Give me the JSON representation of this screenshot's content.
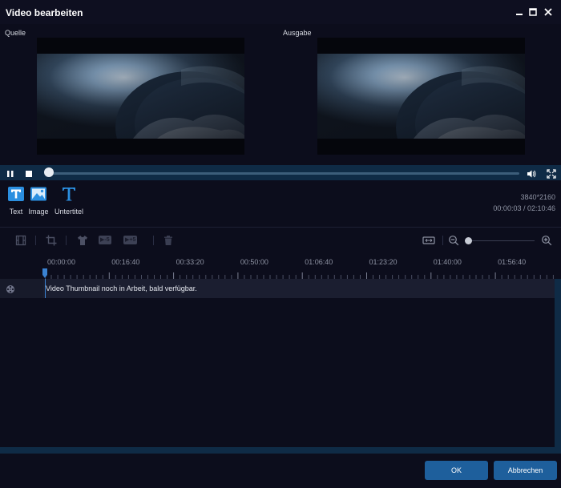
{
  "window": {
    "title": "Video bearbeiten",
    "controls": [
      "close-icon",
      "maximize-icon",
      "minimize-icon"
    ]
  },
  "preview": {
    "source_label": "Quelle",
    "output_label": "Ausgabe"
  },
  "player": {
    "progress_fraction": 0.0004,
    "buttons": [
      "pause-icon",
      "stop-icon",
      "volume-icon",
      "fullscreen-icon"
    ]
  },
  "tools": [
    {
      "label": "Text",
      "icon": "text-icon"
    },
    {
      "label": "Image",
      "icon": "image-icon"
    },
    {
      "label": "Untertitel",
      "icon": "subtitle-icon"
    }
  ],
  "info": {
    "resolution": "3840*2160",
    "time": "00:00:03 / 02:10:46"
  },
  "timeline_toolbar": {
    "icons": [
      "film-icon",
      "crop-icon",
      "shirt-icon",
      "rewind-5-icon",
      "forward-5-icon",
      "trash-icon",
      "fit-width-icon",
      "zoom-out-icon",
      "zoom-in-icon"
    ],
    "rewind_label": "-5",
    "forward_label": "+5",
    "zoom_fraction": 0.0
  },
  "ruler": {
    "labels": [
      "00:00:00",
      "00:16:40",
      "00:33:20",
      "00:50:00",
      "01:06:40",
      "01:23:20",
      "01:40:00",
      "01:56:40"
    ]
  },
  "track": {
    "icon": "film-reel-icon",
    "message": "Video Thumbnail noch in Arbeit, bald verfügbar."
  },
  "footer": {
    "ok_label": "OK",
    "cancel_label": "Abbrechen"
  },
  "colors": {
    "accent": "#1e5f9c",
    "background": "#0c0d1c",
    "bar": "#0f2b46"
  }
}
